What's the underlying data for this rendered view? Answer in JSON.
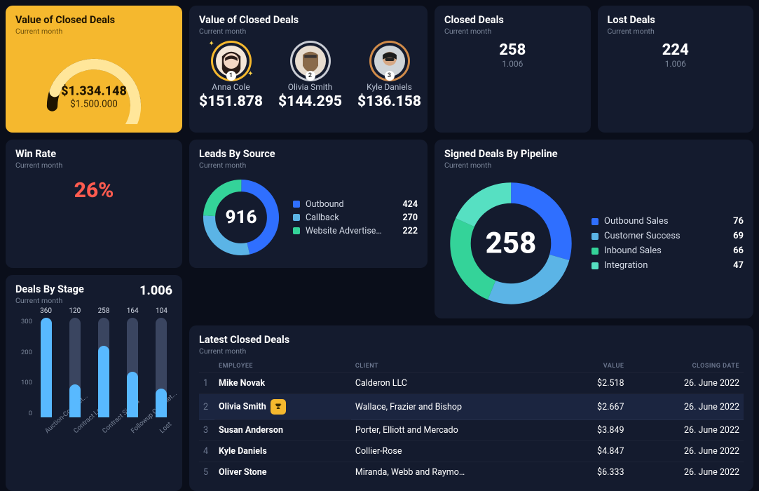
{
  "gauge": {
    "title": "Value of Closed Deals",
    "subtitle": "Current month",
    "value_label": "$1.334.148",
    "max_label": "$1.500.000",
    "value": 1334148,
    "max": 1500000
  },
  "performers_card": {
    "title": "Value of Closed Deals",
    "subtitle": "Current month",
    "people": [
      {
        "name": "Anna Cole",
        "value_label": "$151.878",
        "rank": 1,
        "ring": "#f5b82e"
      },
      {
        "name": "Olivia Smith",
        "value_label": "$144.295",
        "rank": 2,
        "ring": "#c9ccd4"
      },
      {
        "name": "Kyle Daniels",
        "value_label": "$136.158",
        "rank": 3,
        "ring": "#d08b4a"
      }
    ]
  },
  "closed_deals": {
    "title": "Closed Deals",
    "subtitle": "Current month",
    "value": "258",
    "sub": "1.006"
  },
  "lost_deals": {
    "title": "Lost Deals",
    "subtitle": "Current month",
    "value": "224",
    "sub": "1.006"
  },
  "win_rate": {
    "title": "Win Rate",
    "subtitle": "Current month",
    "value": "26%"
  },
  "stages": {
    "title": "Deals By Stage",
    "subtitle": "Current month",
    "total": "1.006",
    "yticks": [
      "300",
      "200",
      "100",
      "0"
    ],
    "items": [
      {
        "label": "Auction-Complet...",
        "value": 360
      },
      {
        "label": "Contract Lost",
        "value": 120
      },
      {
        "label": "Contract Signed",
        "value": 258
      },
      {
        "label": "Followup Complet...",
        "value": 164
      },
      {
        "label": "Lost",
        "value": 104
      }
    ]
  },
  "leads": {
    "title": "Leads By Source",
    "subtitle": "Current month",
    "total": "916",
    "items": [
      {
        "name": "Outbound",
        "value": 424,
        "color": "#2f6fff"
      },
      {
        "name": "Callback",
        "value": 270,
        "color": "#5bb4e6"
      },
      {
        "name": "Website Advertise…",
        "value": 222,
        "color": "#34d399"
      }
    ]
  },
  "signed": {
    "title": "Signed Deals By Pipeline",
    "subtitle": "Current month",
    "total": "258",
    "items": [
      {
        "name": "Outbound Sales",
        "value": 76,
        "color": "#2f6fff"
      },
      {
        "name": "Customer Success",
        "value": 69,
        "color": "#5bb4e6"
      },
      {
        "name": "Inbound Sales",
        "value": 66,
        "color": "#34d399"
      },
      {
        "name": "Integration",
        "value": 47,
        "color": "#56e0c2"
      }
    ]
  },
  "table": {
    "title": "Latest Closed Deals",
    "subtitle": "Current month",
    "columns": {
      "employee": "EMPLOYEE",
      "client": "CLIENT",
      "value": "VALUE",
      "date": "CLOSING DATE"
    },
    "rows": [
      {
        "idx": "1",
        "employee": "Mike Novak",
        "client": "Calderon LLC",
        "value": "$2.518",
        "date": "26. June 2022",
        "trophy": false
      },
      {
        "idx": "2",
        "employee": "Olivia Smith",
        "client": "Wallace, Frazier and Bishop",
        "value": "$2.667",
        "date": "26. June 2022",
        "trophy": true,
        "highlight": true
      },
      {
        "idx": "3",
        "employee": "Susan Anderson",
        "client": "Porter, Elliott and Mercado",
        "value": "$3.849",
        "date": "26. June 2022",
        "trophy": false
      },
      {
        "idx": "4",
        "employee": "Kyle Daniels",
        "client": "Collier-Rose",
        "value": "$4.847",
        "date": "26. June 2022",
        "trophy": false
      },
      {
        "idx": "5",
        "employee": "Oliver Stone",
        "client": "Miranda, Webb and Raymo…",
        "value": "$6.333",
        "date": "26. June 2022",
        "trophy": false
      }
    ]
  },
  "chart_data": [
    {
      "type": "bar",
      "title": "Deals By Stage",
      "categories": [
        "Auction-Completed",
        "Contract Lost",
        "Contract Signed",
        "Followup Completed",
        "Lost"
      ],
      "values": [
        360,
        120,
        258,
        164,
        104
      ],
      "ylim": [
        0,
        360
      ],
      "total": 1006
    },
    {
      "type": "pie",
      "title": "Leads By Source",
      "series": [
        {
          "name": "Outbound",
          "value": 424
        },
        {
          "name": "Callback",
          "value": 270
        },
        {
          "name": "Website Advertisement",
          "value": 222
        }
      ],
      "total": 916
    },
    {
      "type": "pie",
      "title": "Signed Deals By Pipeline",
      "series": [
        {
          "name": "Outbound Sales",
          "value": 76
        },
        {
          "name": "Customer Success",
          "value": 69
        },
        {
          "name": "Inbound Sales",
          "value": 66
        },
        {
          "name": "Integration",
          "value": 47
        }
      ],
      "total": 258
    },
    {
      "type": "table",
      "title": "Latest Closed Deals",
      "columns": [
        "Employee",
        "Client",
        "Value",
        "Closing Date"
      ],
      "rows": [
        [
          "Mike Novak",
          "Calderon LLC",
          2518,
          "26. June 2022"
        ],
        [
          "Olivia Smith",
          "Wallace, Frazier and Bishop",
          2667,
          "26. June 2022"
        ],
        [
          "Susan Anderson",
          "Porter, Elliott and Mercado",
          3849,
          "26. June 2022"
        ],
        [
          "Kyle Daniels",
          "Collier-Rose",
          4847,
          "26. June 2022"
        ],
        [
          "Oliver Stone",
          "Miranda, Webb and Raymond",
          6333,
          "26. June 2022"
        ]
      ]
    }
  ]
}
